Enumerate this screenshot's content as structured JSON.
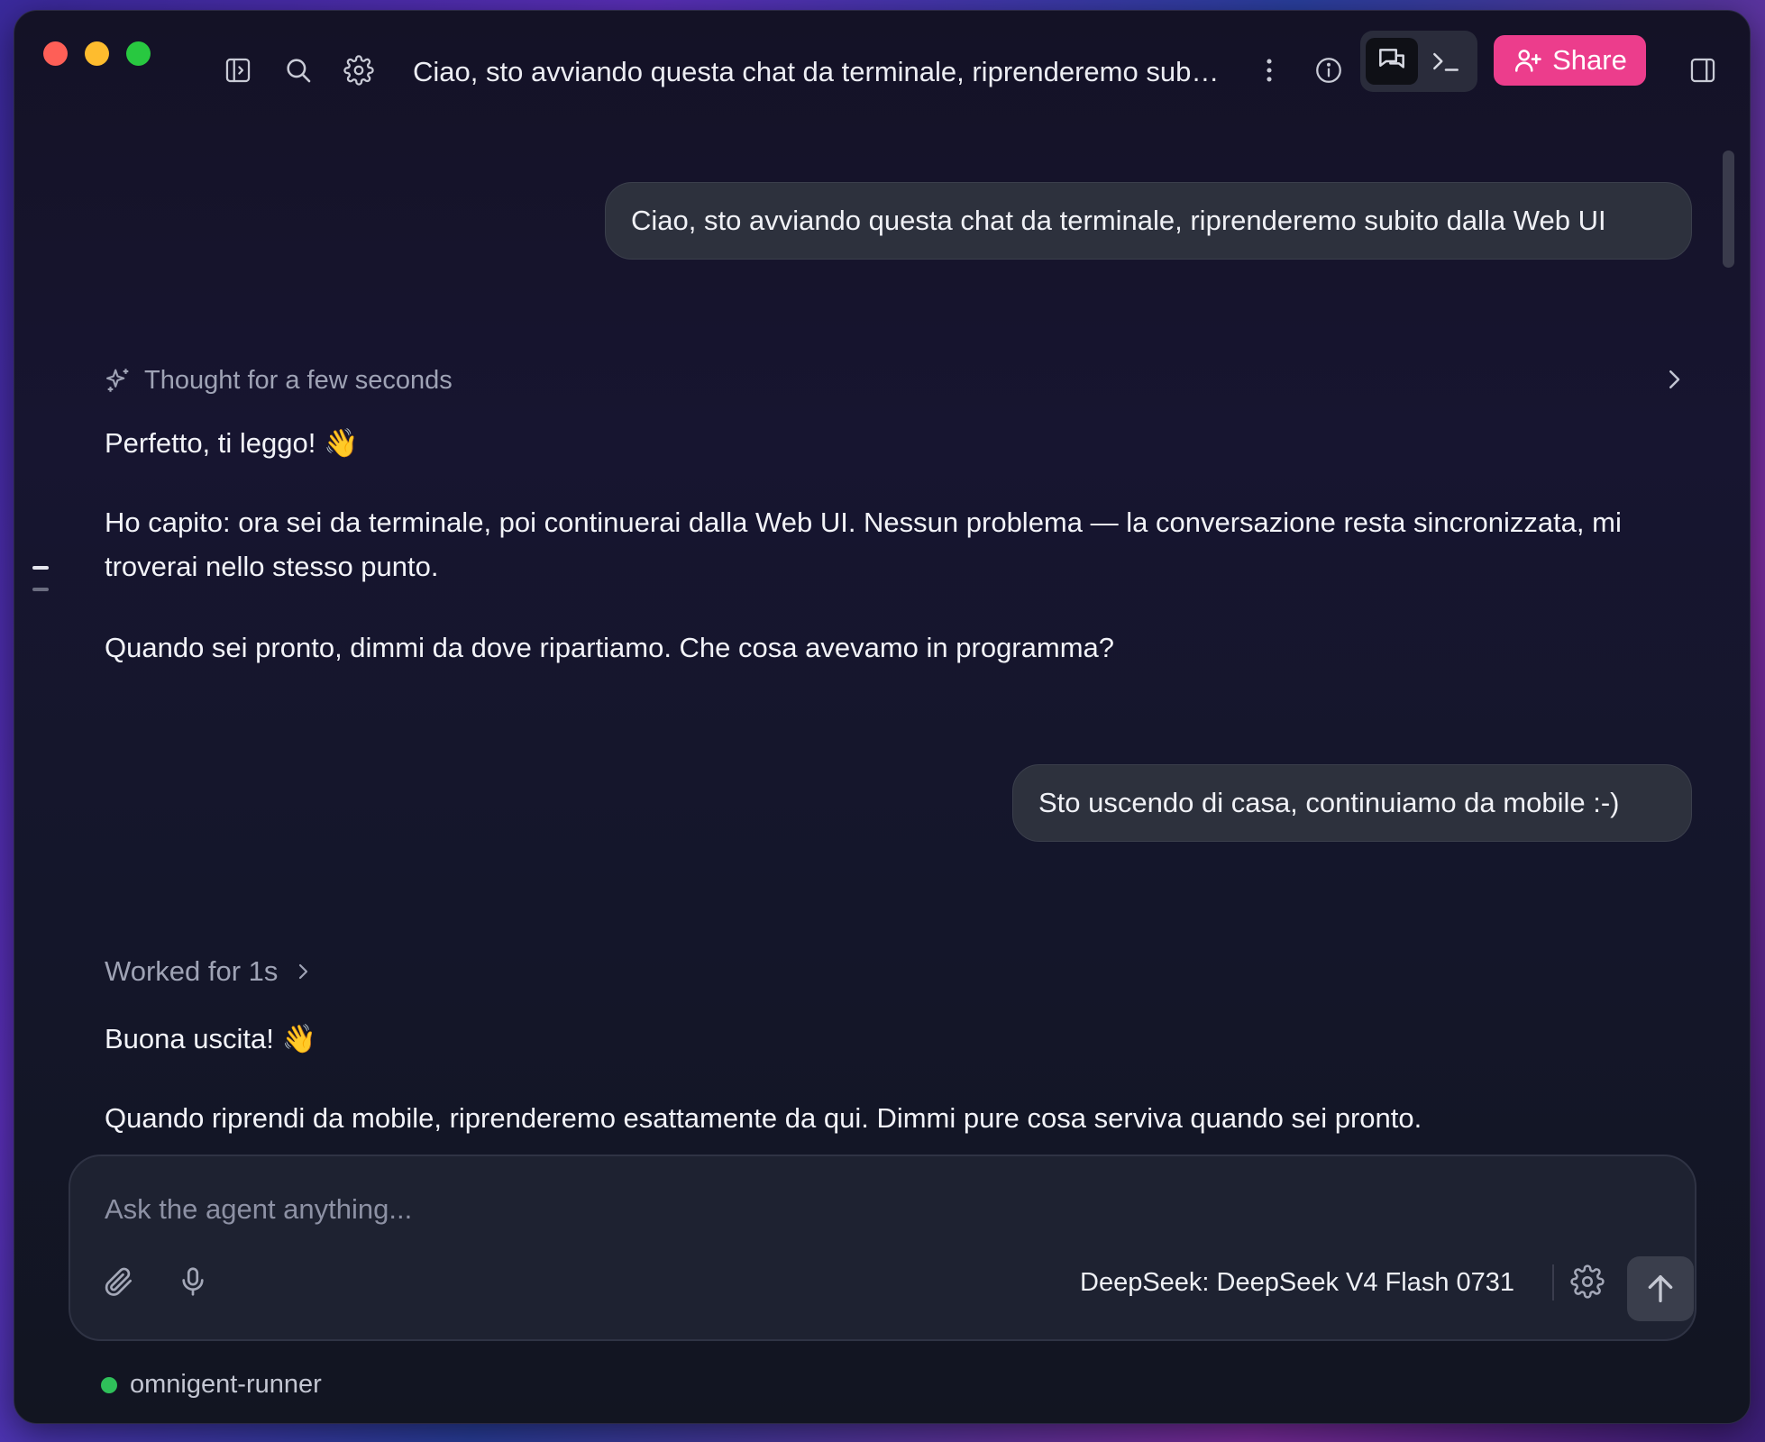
{
  "titlebar": {
    "title": "Ciao, sto avviando questa chat da terminale, riprenderemo subito dalla Web UI",
    "share_label": "Share",
    "icons": [
      "sidebar-toggle-icon",
      "search-icon",
      "gear-icon",
      "more-vertical-icon",
      "info-icon",
      "chat-bubbles-icon",
      "terminal-icon",
      "user-plus-icon",
      "right-panel-icon"
    ]
  },
  "conversation": {
    "user_message_1": "Ciao, sto avviando questa chat da terminale, riprenderemo subito dalla Web UI",
    "thought_label": "Thought for a few seconds",
    "assistant_1": {
      "p1": "Perfetto, ti leggo! 👋",
      "p2": "Ho capito: ora sei da terminale, poi continuerai dalla Web UI. Nessun problema — la conversazione resta sincronizzata, mi troverai nello stesso punto.",
      "p3": "Quando sei pronto, dimmi da dove ripartiamo. Che cosa avevamo in programma?"
    },
    "user_message_2": "Sto uscendo di casa, continuiamo da mobile :-)",
    "worked_label": "Worked for 1s",
    "assistant_2": {
      "p1": "Buona uscita! 👋",
      "p2": "Quando riprendi da mobile, riprenderemo esattamente da qui. Dimmi pure cosa serviva quando sei pronto."
    }
  },
  "composer": {
    "placeholder": "Ask the agent anything...",
    "value": "",
    "model": "DeepSeek: DeepSeek V4 Flash 0731"
  },
  "status": {
    "runner": "omnigent-runner",
    "color": "#2fc05a"
  },
  "colors": {
    "accent": "#ec3d8c",
    "background": "#141226",
    "bubble": "#2d313d"
  }
}
